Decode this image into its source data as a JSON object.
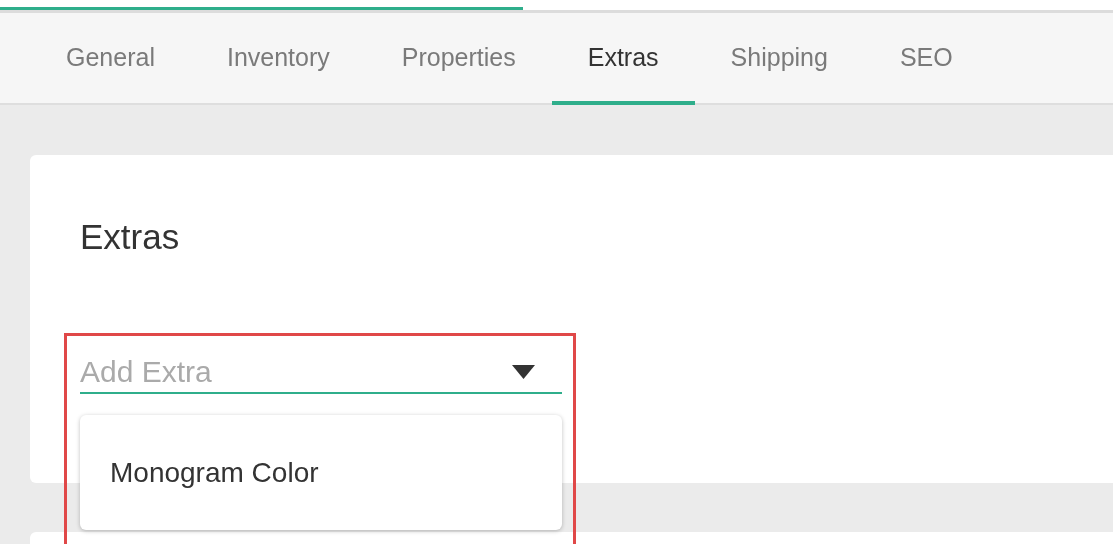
{
  "progress": {
    "level": 0.47
  },
  "tabs": [
    {
      "label": "General",
      "selected": false
    },
    {
      "label": "Inventory",
      "selected": false
    },
    {
      "label": "Properties",
      "selected": false
    },
    {
      "label": "Extras",
      "selected": true
    },
    {
      "label": "Shipping",
      "selected": false
    },
    {
      "label": "SEO",
      "selected": false
    }
  ],
  "card": {
    "title": "Extras",
    "select": {
      "placeholder": "Add Extra",
      "expanded": true,
      "options": [
        {
          "label": "Monogram Color",
          "selected": false
        }
      ]
    }
  }
}
